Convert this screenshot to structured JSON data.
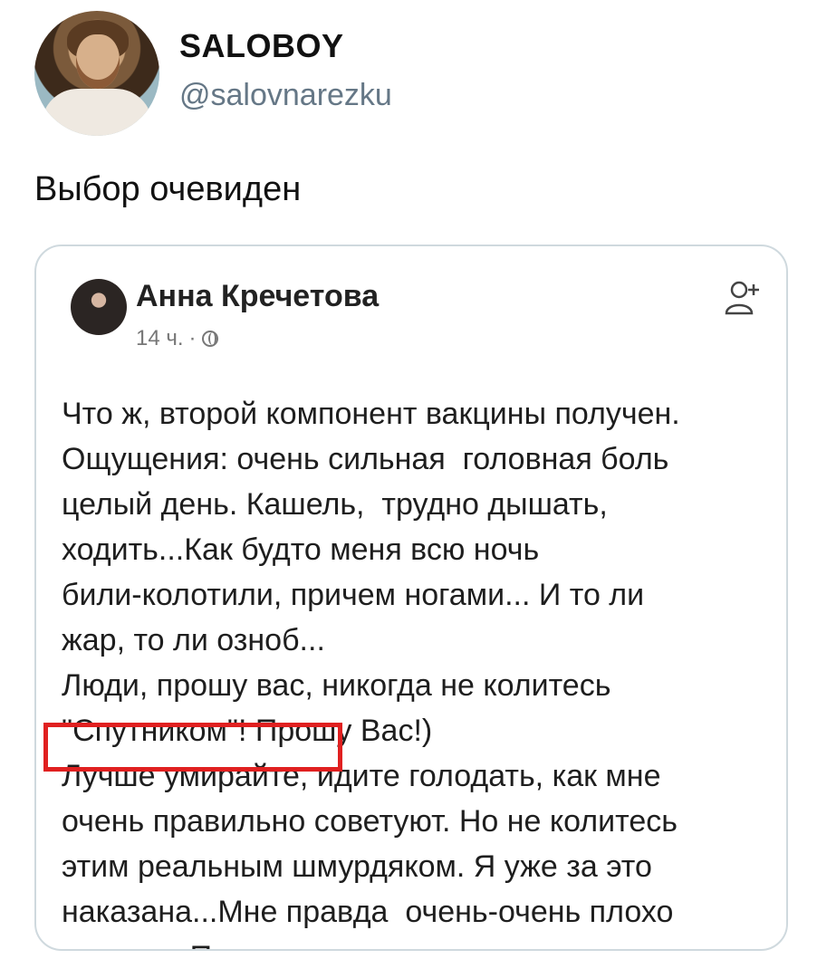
{
  "tweet": {
    "display_name": "SALOBOY",
    "handle": "@salovnarezku",
    "text": "Выбор очевиден"
  },
  "embedded_post": {
    "author": "Анна Кречетова",
    "time": "14 ч.",
    "separator": "·",
    "body": "Что ж, второй компонент вакцины получен.\nОщущения: очень сильная  головная боль\nцелый день. Кашель,  трудно дышать,\nходить...Как будто меня всю ночь\nбили-колотили, причем ногами... И то ли\nжар, то ли озноб...\nЛюди, прошу вас, никогда не колитесь\n\"Спутником\"! Прошу Вас!)\nЛучше умирайте, идите голодать, как мне\nочень правильно советуют. Но не колитесь\nэтим реальным шмурдяком. Я уже за это\nнаказана...Мне правда  очень-очень плохо\nсегодня. Просто жесть..."
  },
  "colors": {
    "highlight": "#e02020",
    "handle": "#657786",
    "border": "#cfd9de"
  },
  "icons": [
    "globe-icon",
    "add-friend-icon"
  ]
}
